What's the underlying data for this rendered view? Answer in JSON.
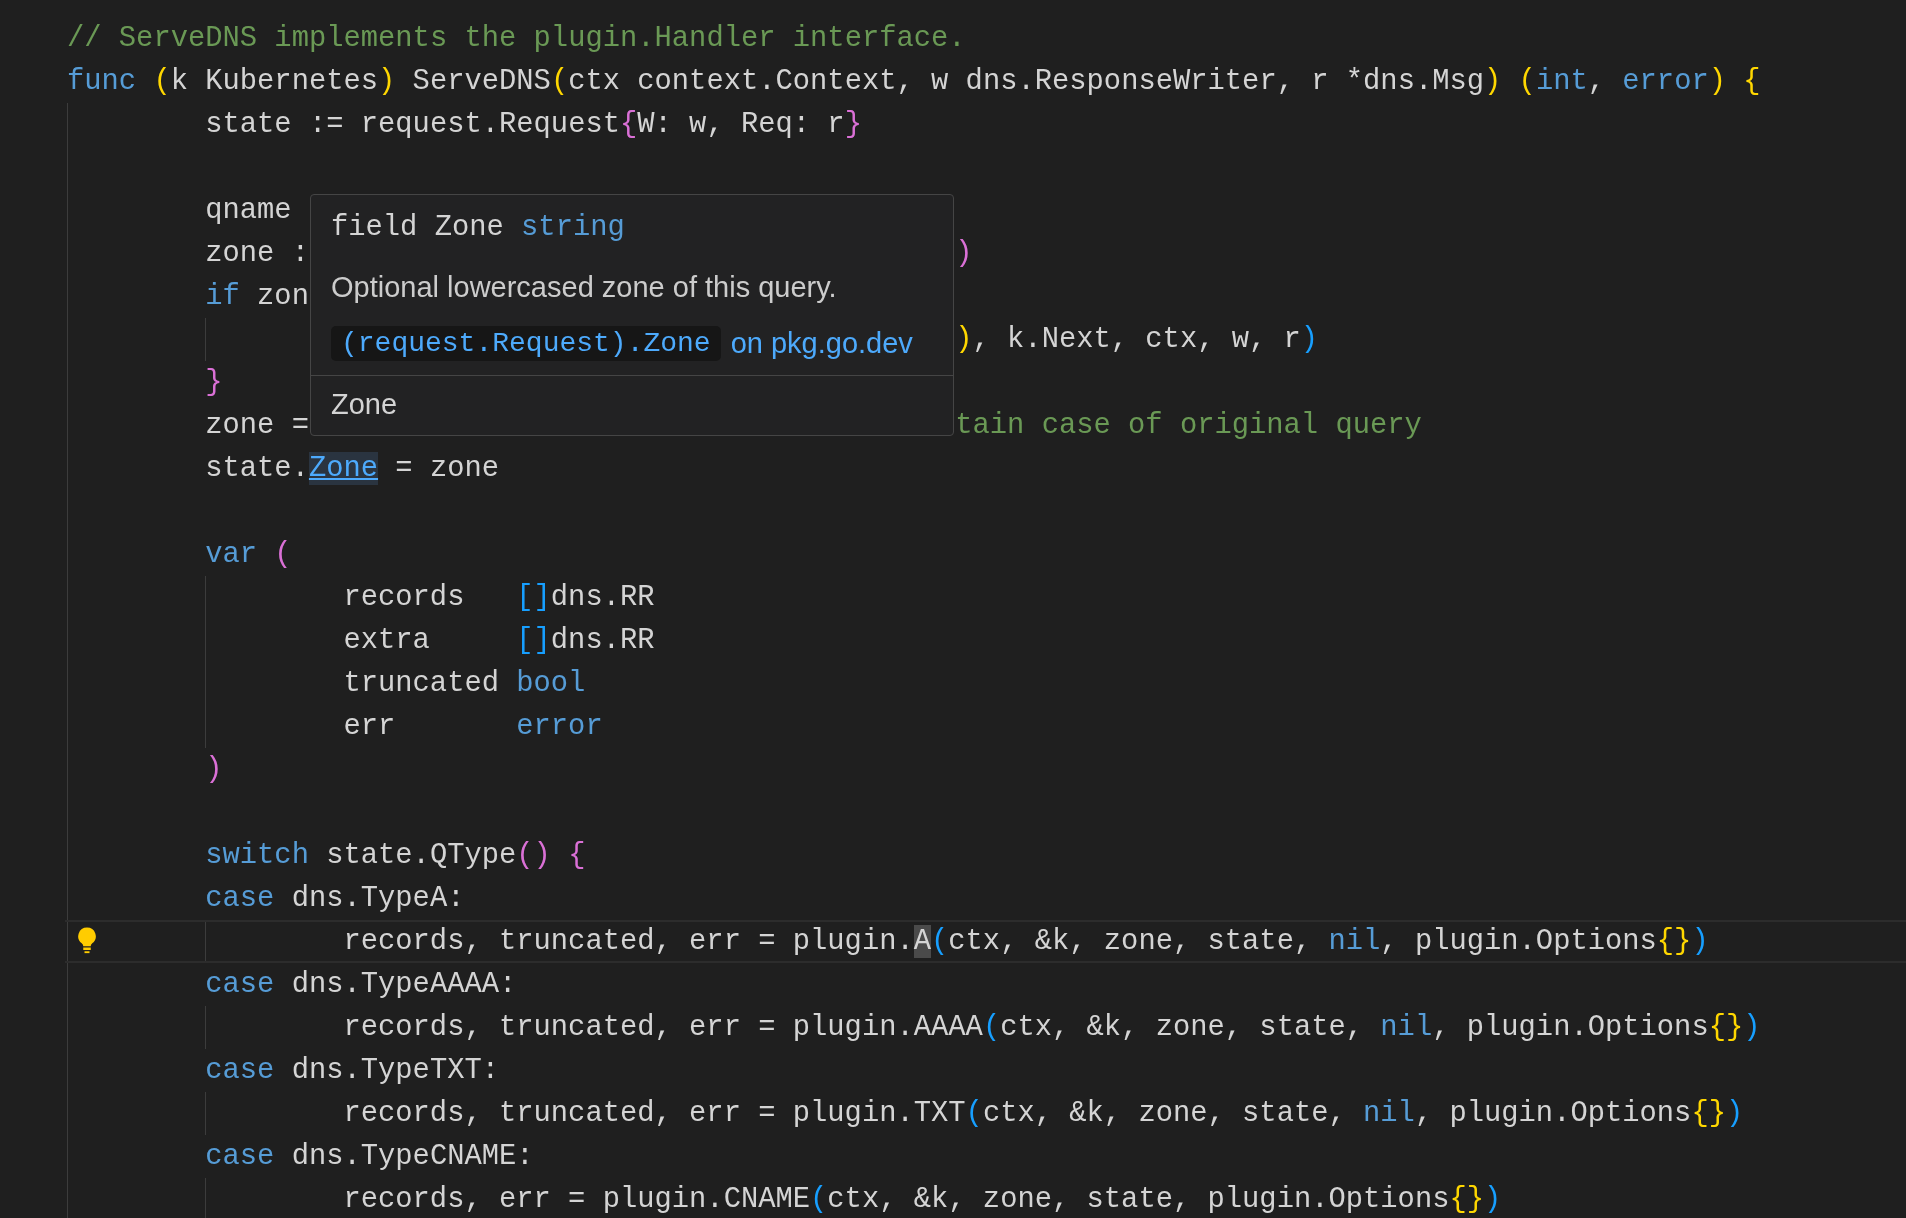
{
  "editor": {
    "lines": [
      {
        "current": false,
        "lightbulb": false,
        "tokens": [
          {
            "kind": "comment",
            "text": "// ServeDNS implements the plugin.Handler interface."
          }
        ]
      },
      {
        "current": false,
        "lightbulb": false,
        "tokens": [
          {
            "kind": "keyword",
            "text": "func"
          },
          {
            "kind": "gold",
            "text": " ("
          },
          {
            "kind": "plain",
            "text": "k Kubernetes"
          },
          {
            "kind": "gold",
            "text": ")"
          },
          {
            "kind": "plain",
            "text": " ServeDNS"
          },
          {
            "kind": "gold",
            "text": "("
          },
          {
            "kind": "plain",
            "text": "ctx context.Context, w dns.ResponseWriter, r *dns.Msg"
          },
          {
            "kind": "gold",
            "text": ")"
          },
          {
            "kind": "gold",
            "text": " ("
          },
          {
            "kind": "keyword",
            "text": "int"
          },
          {
            "kind": "plain",
            "text": ", "
          },
          {
            "kind": "keyword",
            "text": "error"
          },
          {
            "kind": "gold",
            "text": ")"
          },
          {
            "kind": "gold",
            "text": " {"
          }
        ]
      },
      {
        "current": false,
        "lightbulb": false,
        "tokens": [
          {
            "kind": "plain",
            "text": "\tstate := request.Request"
          },
          {
            "kind": "orchid",
            "text": "{"
          },
          {
            "kind": "plain",
            "text": "W: w, Req: r"
          },
          {
            "kind": "orchid",
            "text": "}"
          }
        ]
      },
      {
        "current": false,
        "lightbulb": false
      },
      {
        "current": false,
        "lightbulb": false,
        "tokens": [
          {
            "kind": "plain",
            "text": "\tqname"
          }
        ]
      },
      {
        "current": false,
        "lightbulb": false,
        "tokens": [
          {
            "kind": "plain",
            "text": "\tzone :"
          }
        ],
        "after_tooltip": [
          {
            "kind": "orchid",
            "text": ")"
          }
        ]
      },
      {
        "current": false,
        "lightbulb": false,
        "tokens": [
          {
            "kind": "keyword",
            "text": "\tif"
          },
          {
            "kind": "plain",
            "text": " zon"
          }
        ]
      },
      {
        "current": false,
        "lightbulb": false,
        "after_tooltip": [
          {
            "kind": "gold",
            "text": ")"
          },
          {
            "kind": "plain",
            "text": ", k.Next, ctx, w, r"
          },
          {
            "kind": "azure",
            "text": ")"
          }
        ]
      },
      {
        "current": false,
        "lightbulb": false,
        "tokens": [
          {
            "kind": "orchid",
            "text": "\t}"
          }
        ]
      },
      {
        "current": false,
        "lightbulb": false,
        "tokens": [
          {
            "kind": "plain",
            "text": "\tzone ="
          }
        ],
        "after_tooltip": [
          {
            "kind": "comment",
            "text": "tain case of original query"
          }
        ]
      },
      {
        "current": false,
        "lightbulb": false,
        "tokens": [
          {
            "kind": "plain",
            "text": "\tstate."
          },
          {
            "kind": "hovered",
            "text": "Zone"
          },
          {
            "kind": "plain",
            "text": " = zone"
          }
        ]
      },
      {
        "current": false,
        "lightbulb": false
      },
      {
        "current": false,
        "lightbulb": false,
        "tokens": [
          {
            "kind": "keyword",
            "text": "\tvar"
          },
          {
            "kind": "orchid",
            "text": " ("
          }
        ]
      },
      {
        "current": false,
        "lightbulb": false,
        "tokens": [
          {
            "kind": "plain",
            "text": "\t\trecords   "
          },
          {
            "kind": "azure",
            "text": "[]"
          },
          {
            "kind": "plain",
            "text": "dns.RR"
          }
        ]
      },
      {
        "current": false,
        "lightbulb": false,
        "tokens": [
          {
            "kind": "plain",
            "text": "\t\textra     "
          },
          {
            "kind": "azure",
            "text": "[]"
          },
          {
            "kind": "plain",
            "text": "dns.RR"
          }
        ]
      },
      {
        "current": false,
        "lightbulb": false,
        "tokens": [
          {
            "kind": "plain",
            "text": "\t\ttruncated "
          },
          {
            "kind": "keyword",
            "text": "bool"
          }
        ]
      },
      {
        "current": false,
        "lightbulb": false,
        "tokens": [
          {
            "kind": "plain",
            "text": "\t\terr       "
          },
          {
            "kind": "keyword",
            "text": "error"
          }
        ]
      },
      {
        "current": false,
        "lightbulb": false,
        "tokens": [
          {
            "kind": "orchid",
            "text": "\t)"
          }
        ]
      },
      {
        "current": false,
        "lightbulb": false
      },
      {
        "current": false,
        "lightbulb": false,
        "tokens": [
          {
            "kind": "keyword",
            "text": "\tswitch"
          },
          {
            "kind": "plain",
            "text": " state.QType"
          },
          {
            "kind": "orchid",
            "text": "()"
          },
          {
            "kind": "orchid",
            "text": " {"
          }
        ]
      },
      {
        "current": false,
        "lightbulb": false,
        "tokens": [
          {
            "kind": "keyword",
            "text": "\tcase"
          },
          {
            "kind": "plain",
            "text": " dns.TypeA:"
          }
        ]
      },
      {
        "current": true,
        "lightbulb": true,
        "tokens": [
          {
            "kind": "plain",
            "text": "\t\trecords, truncated, err = plugin."
          },
          {
            "kind": "cursor",
            "text": "A"
          },
          {
            "kind": "azure",
            "text": "("
          },
          {
            "kind": "plain",
            "text": "ctx, &k, zone, state, "
          },
          {
            "kind": "keyword",
            "text": "nil"
          },
          {
            "kind": "plain",
            "text": ", plugin.Options"
          },
          {
            "kind": "gold",
            "text": "{}"
          },
          {
            "kind": "azure",
            "text": ")"
          }
        ]
      },
      {
        "current": false,
        "lightbulb": false,
        "tokens": [
          {
            "kind": "keyword",
            "text": "\tcase"
          },
          {
            "kind": "plain",
            "text": " dns.TypeAAAA:"
          }
        ]
      },
      {
        "current": false,
        "lightbulb": false,
        "tokens": [
          {
            "kind": "plain",
            "text": "\t\trecords, truncated, err = plugin.AAAA"
          },
          {
            "kind": "azure",
            "text": "("
          },
          {
            "kind": "plain",
            "text": "ctx, &k, zone, state, "
          },
          {
            "kind": "keyword",
            "text": "nil"
          },
          {
            "kind": "plain",
            "text": ", plugin.Options"
          },
          {
            "kind": "gold",
            "text": "{}"
          },
          {
            "kind": "azure",
            "text": ")"
          }
        ]
      },
      {
        "current": false,
        "lightbulb": false,
        "tokens": [
          {
            "kind": "keyword",
            "text": "\tcase"
          },
          {
            "kind": "plain",
            "text": " dns.TypeTXT:"
          }
        ]
      },
      {
        "current": false,
        "lightbulb": false,
        "tokens": [
          {
            "kind": "plain",
            "text": "\t\trecords, truncated, err = plugin.TXT"
          },
          {
            "kind": "azure",
            "text": "("
          },
          {
            "kind": "plain",
            "text": "ctx, &k, zone, state, "
          },
          {
            "kind": "keyword",
            "text": "nil"
          },
          {
            "kind": "plain",
            "text": ", plugin.Options"
          },
          {
            "kind": "gold",
            "text": "{}"
          },
          {
            "kind": "azure",
            "text": ")"
          }
        ]
      },
      {
        "current": false,
        "lightbulb": false,
        "tokens": [
          {
            "kind": "keyword",
            "text": "\tcase"
          },
          {
            "kind": "plain",
            "text": " dns.TypeCNAME:"
          }
        ]
      },
      {
        "current": false,
        "lightbulb": false,
        "tokens": [
          {
            "kind": "plain",
            "text": "\t\trecords, err = plugin.CNAME"
          },
          {
            "kind": "azure",
            "text": "("
          },
          {
            "kind": "plain",
            "text": "ctx, &k, zone, state, plugin.Options"
          },
          {
            "kind": "gold",
            "text": "{}"
          },
          {
            "kind": "azure",
            "text": ")"
          }
        ]
      }
    ],
    "hover": {
      "signature": [
        {
          "kind": "plain",
          "text": "field Zone "
        },
        {
          "kind": "keyword",
          "text": "string"
        }
      ],
      "doc": "Optional lowercased zone of this query.",
      "reference": "(request.Request).Zone",
      "source_link": "on pkg.go.dev",
      "footer": "Zone"
    }
  }
}
